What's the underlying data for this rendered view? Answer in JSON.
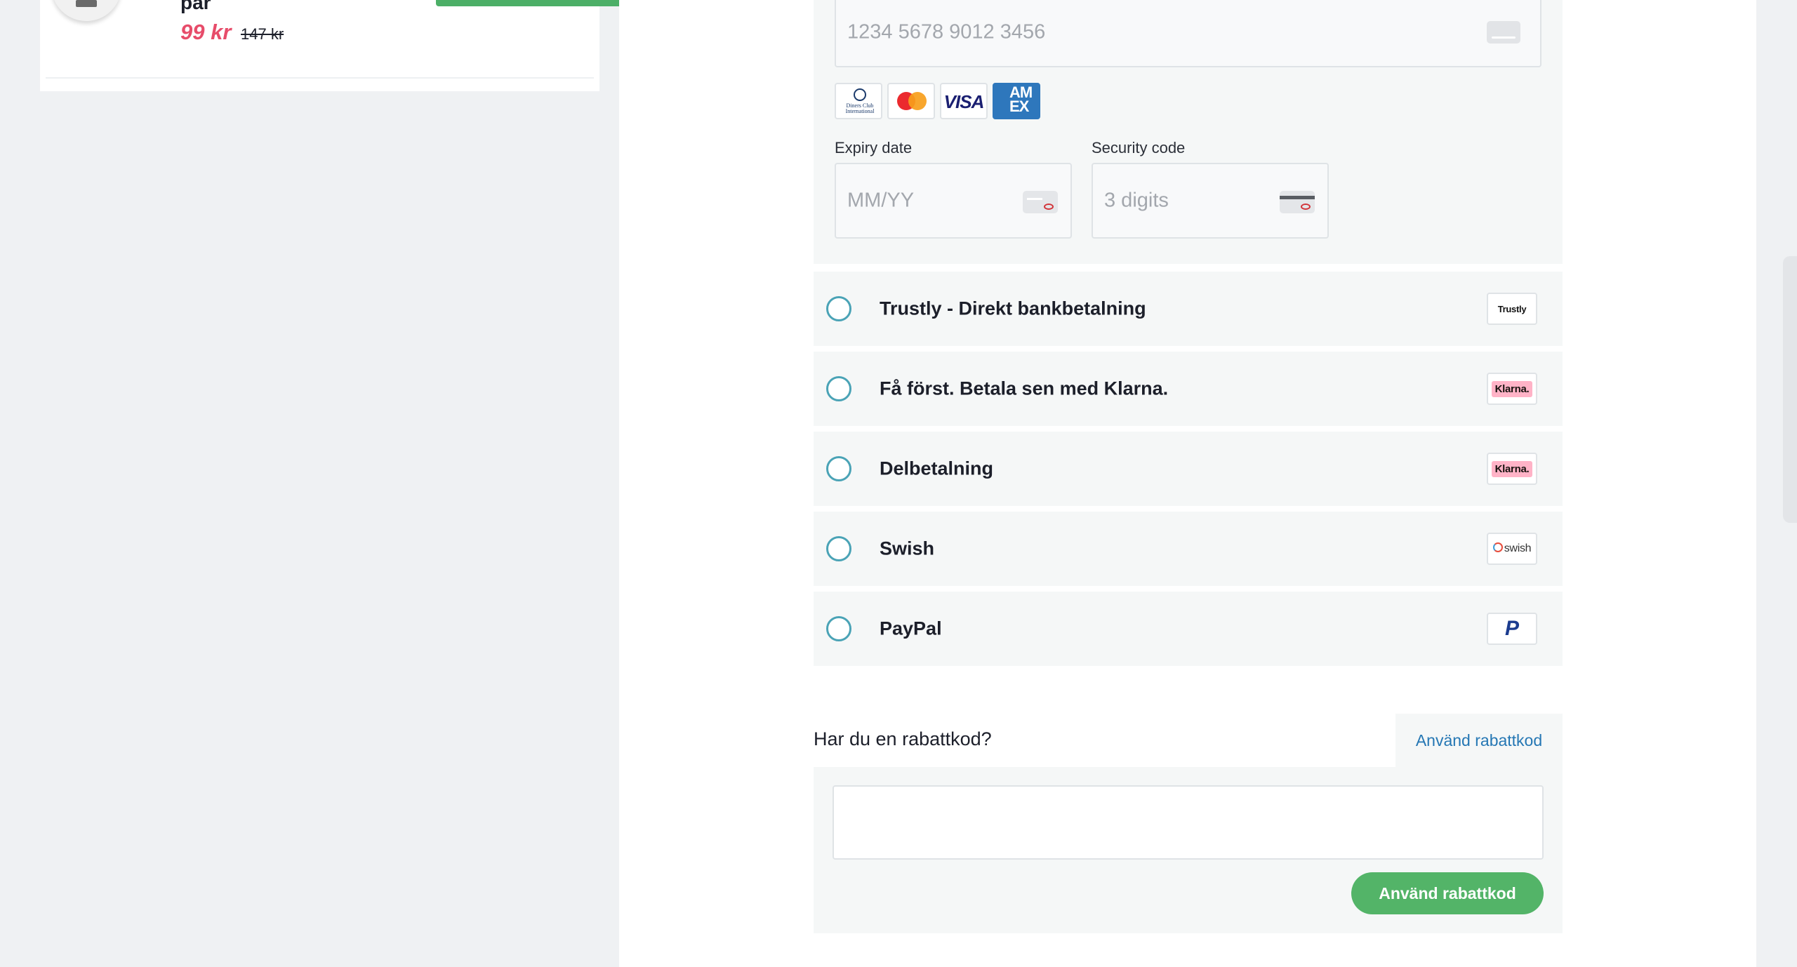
{
  "summary": {
    "product_name": "par",
    "price_sale": "99 kr",
    "price_old": "147 kr"
  },
  "card_form": {
    "card_number_placeholder": "1234 5678 9012 3456",
    "brands": [
      "diners-club",
      "mastercard",
      "visa",
      "amex"
    ],
    "diners_text": "Diners Club International",
    "visa_text": "VISA",
    "amex_text": "AM EX",
    "expiry_label": "Expiry date",
    "expiry_placeholder": "MM/YY",
    "security_label": "Security code",
    "security_placeholder": "3 digits"
  },
  "payment_options": [
    {
      "label": "Trustly - Direkt bankbetalning",
      "logo": "Trustly"
    },
    {
      "label": "Få först. Betala sen med Klarna.",
      "logo": "Klarna."
    },
    {
      "label": "Delbetalning",
      "logo": "Klarna."
    },
    {
      "label": "Swish",
      "logo": "swish"
    },
    {
      "label": "PayPal",
      "logo": "P"
    }
  ],
  "discount": {
    "question": "Har du en rabattkod?",
    "toggle_link": "Använd rabattkod",
    "input_value": "",
    "submit_label": "Använd rabattkod"
  },
  "colors": {
    "accent_green": "#53b468",
    "radio_teal": "#4aa3b6",
    "sale_red": "#e74c6a",
    "link_blue": "#2577b4"
  }
}
